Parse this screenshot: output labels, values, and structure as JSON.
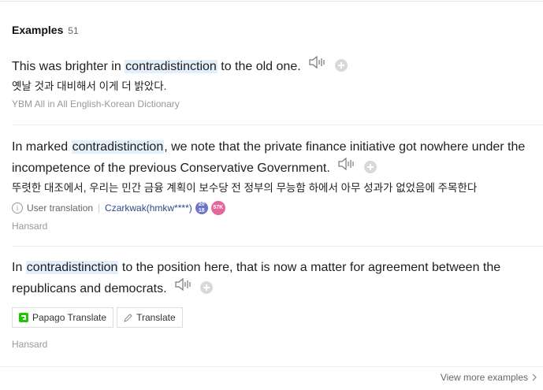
{
  "header": {
    "title": "Examples",
    "count": "51"
  },
  "examples": [
    {
      "en_before": "This was brighter in ",
      "highlight": "contradistinction",
      "en_after": " to the old one.",
      "ko": "옛날 것과 대비해서 이게 더 밝았다.",
      "source": "YBM All in All English-Korean Dictionary"
    },
    {
      "en_before": "In marked ",
      "highlight": "contradistinction",
      "en_after": ", we note that the private finance initiative got nowhere under the incompetence of the previous Conservative Government.",
      "ko": "뚜렷한 대조에서, 우리는 민간 금융 계획이 보수당 전 정부의 무능함 하에서 아무 성과가 없었음에 주목한다",
      "user_translation_label": "User translation",
      "user": "Czarkwak(hmkw****)",
      "badge1": "20 18",
      "badge2": "57K",
      "source": "Hansard"
    },
    {
      "en_before": "In ",
      "highlight": "contradistinction",
      "en_after": " to the position here, that is now a matter for agreement between the republicans and democrats.",
      "papago_label": "Papago Translate",
      "translate_label": "Translate",
      "source": "Hansard"
    }
  ],
  "footer": {
    "more_label": "View more examples"
  },
  "colors": {
    "highlight": "#e3f0fb",
    "user_link": "#2a4b8d",
    "badge1": "#6d74c9",
    "badge2": "#e4679a"
  }
}
